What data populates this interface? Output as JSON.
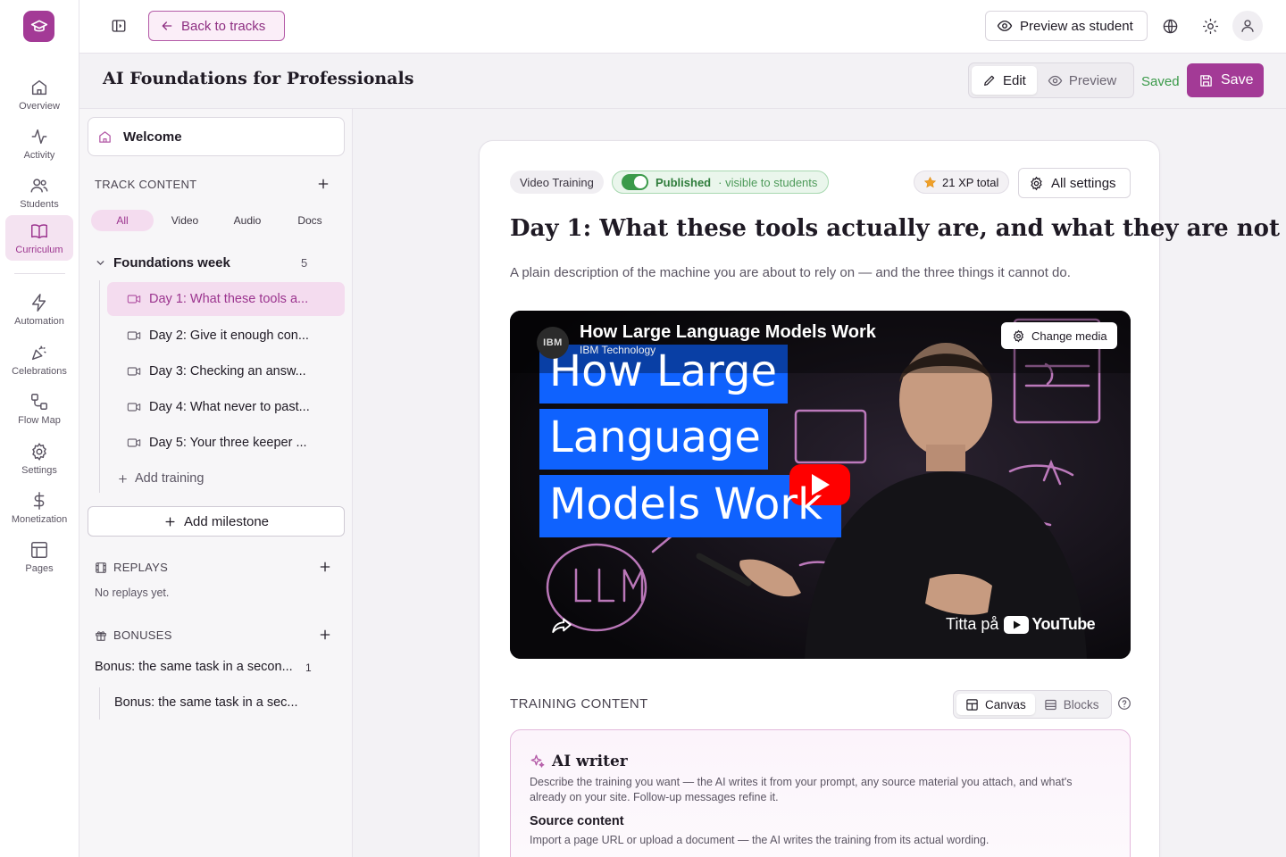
{
  "rail": {
    "items": [
      {
        "label": "Overview",
        "icon": "home-icon"
      },
      {
        "label": "Activity",
        "icon": "activity-icon"
      },
      {
        "label": "Students",
        "icon": "users-icon"
      },
      {
        "label": "Curriculum",
        "icon": "book-icon"
      },
      {
        "label": "Automation",
        "icon": "bolt-icon"
      },
      {
        "label": "Celebrations",
        "icon": "party-icon"
      },
      {
        "label": "Flow Map",
        "icon": "flow-icon"
      },
      {
        "label": "Settings",
        "icon": "gear-icon"
      },
      {
        "label": "Monetization",
        "icon": "dollar-icon"
      },
      {
        "label": "Pages",
        "icon": "layout-icon"
      }
    ],
    "active": "Curriculum"
  },
  "topbar": {
    "back_label": "Back to tracks",
    "preview_student_label": "Preview as student"
  },
  "header": {
    "title": "AI Foundations for Professionals",
    "edit_label": "Edit",
    "preview_label": "Preview",
    "saved_label": "Saved",
    "save_label": "Save"
  },
  "sidebar": {
    "welcome": "Welcome",
    "track_content_label": "TRACK CONTENT",
    "filters": [
      "All",
      "Video",
      "Audio",
      "Docs"
    ],
    "active_filter": "All",
    "group": {
      "name": "Foundations week",
      "count": "5"
    },
    "lessons": [
      "Day 1: What these tools a...",
      "Day 2: Give it enough con...",
      "Day 3: Checking an answ...",
      "Day 4: What never to past...",
      "Day 5: Your three keeper ..."
    ],
    "add_training": "Add training",
    "add_milestone": "Add milestone",
    "replays_label": "REPLAYS",
    "replays_empty": "No replays yet.",
    "bonuses_label": "BONUSES",
    "bonus_group": {
      "name": "Bonus: the same task in a secon...",
      "count": "1"
    },
    "bonus_item": "Bonus: the same task in a sec..."
  },
  "lesson": {
    "type_badge": "Video Training",
    "status": "Published",
    "status_sub": "· visible to students",
    "xp": "21 XP total",
    "settings_label": "All settings",
    "title": "Day 1: What these tools actually are, and what they are not",
    "description": "A plain description of the machine you are about to rely on — and the three things it cannot do."
  },
  "video": {
    "channel_logo": "IBM",
    "title": "How Large Language Models Work",
    "channel": "IBM Technology",
    "change_media": "Change media",
    "thumb_lines": [
      "How Large",
      "Language",
      "Models Work"
    ],
    "watch_on": "Titta på",
    "youtube": "YouTube"
  },
  "training_content": {
    "label": "TRAINING CONTENT",
    "canvas_label": "Canvas",
    "blocks_label": "Blocks"
  },
  "ai_writer": {
    "title": "AI writer",
    "description": "Describe the training you want — the AI writes it from your prompt, any source material you attach, and what's already on your site. Follow-up messages refine it.",
    "source_title": "Source content",
    "source_description": "Import a page URL or upload a document — the AI writes the training from its actual wording."
  },
  "colors": {
    "brand": "#a33a96",
    "success": "#3b9a4a",
    "youtube_red": "#ff0000"
  }
}
